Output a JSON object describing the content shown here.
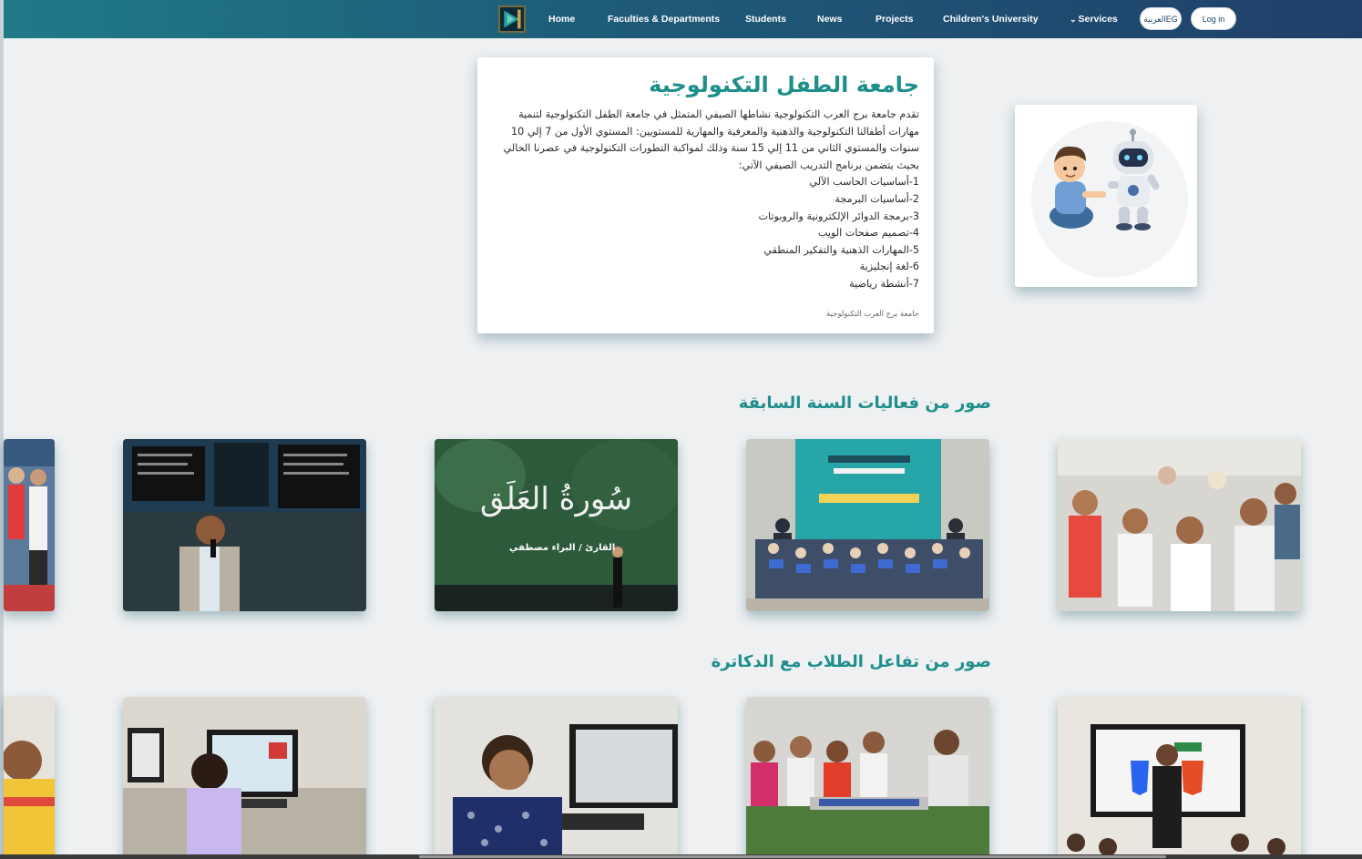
{
  "nav": {
    "items": [
      {
        "label": "Home"
      },
      {
        "label": "Faculties & Departments"
      },
      {
        "label": "Students"
      },
      {
        "label": "News"
      },
      {
        "label": "Projects"
      },
      {
        "label": "Children's University"
      },
      {
        "label": "Services"
      }
    ],
    "lang_label": "العربية",
    "lang_code": "EG",
    "login_label": "Log in"
  },
  "info": {
    "title": "جامعة الطفل التكنولوجية",
    "paragraph": "تقدم جامعة برج العرب التكنولوجية نشاطها الصيفي المتمثل في جامعة الطفل التكنولوجية لتنمية مهارات أطفالنا التكنولوجية والذهنية والمعرفية والمهارية للمستويين: المستوي الأول من 7 إلي 10 سنوات والمستوي الثاني من 11 إلي 15 سنة وذلك لمواكبة التطورات التكنولوجية في عصرنا الحالي بحيث يتضمن برنامج التدريب الصيفي الآتي:",
    "list": [
      "1-أساسيات الحاسب الآلي",
      "2-أساسيات البرمجة",
      "3-برمجة الدوائر الإلكترونية والروبوتات",
      "4-تصميم صفحات الويب",
      "5-المهارات الذهنية والتفكير المنطقي",
      "6-لغة إنجليزية",
      "7-أنشطة رياضية"
    ],
    "source": "جامعة برج العرب التكنولوجية"
  },
  "sections": {
    "events_title": "صور من فعاليات السنة السابقة",
    "interaction_title": "صور من تفاعل الطلاب مع الدكاترة"
  },
  "photos": {
    "quran_title": "سُورةُ العَلَق",
    "quran_caption": "القارئ / البراء مصطفي"
  },
  "colors": {
    "accent": "#1f8f8c",
    "nav_start": "#1f7a86",
    "nav_end": "#20406a"
  }
}
